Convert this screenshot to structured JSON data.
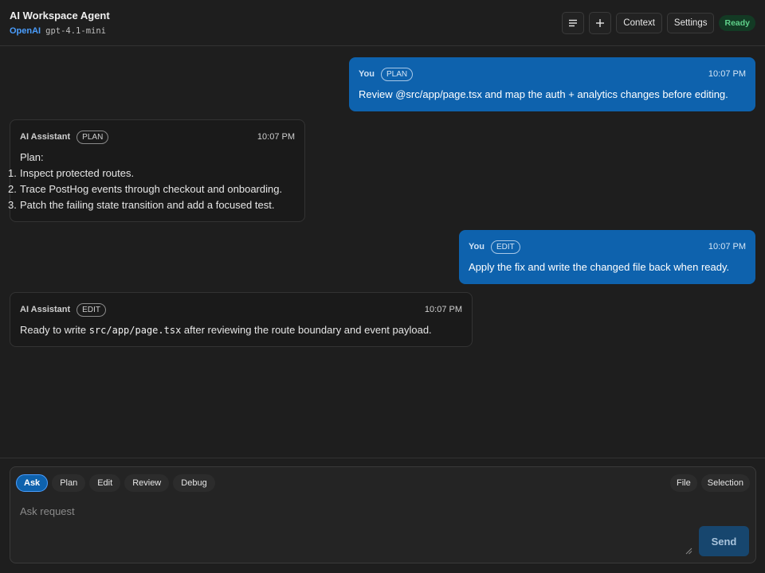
{
  "header": {
    "title": "AI Workspace Agent",
    "provider": "OpenAI",
    "model": "gpt-4.1-mini",
    "context_label": "Context",
    "settings_label": "Settings",
    "status": "Ready"
  },
  "messages": [
    {
      "role": "user",
      "author": "You",
      "mode": "PLAN",
      "time": "10:07 PM",
      "text": "Review @src/app/page.tsx and map the auth + analytics changes before editing."
    },
    {
      "role": "assistant",
      "author": "AI Assistant",
      "mode": "PLAN",
      "time": "10:07 PM",
      "intro": "Plan:",
      "steps": [
        {
          "num": "1.",
          "text": "Inspect protected routes."
        },
        {
          "num": "2.",
          "text": "Trace PostHog events through checkout and onboarding."
        },
        {
          "num": "3.",
          "text": "Patch the failing state transition and add a focused test."
        }
      ]
    },
    {
      "role": "user",
      "author": "You",
      "mode": "EDIT",
      "time": "10:07 PM",
      "text": "Apply the fix and write the changed file back when ready."
    },
    {
      "role": "assistant",
      "author": "AI Assistant",
      "mode": "EDIT",
      "time": "10:07 PM",
      "text_before": "Ready to write ",
      "code": "src/app/page.tsx",
      "text_after": " after reviewing the route boundary and event payload."
    }
  ],
  "composer": {
    "modes": [
      "Ask",
      "Plan",
      "Edit",
      "Review",
      "Debug"
    ],
    "active_mode": "Ask",
    "file_label": "File",
    "selection_label": "Selection",
    "placeholder": "Ask request",
    "value": "",
    "send_label": "Send"
  },
  "colors": {
    "accent": "#0e62ad",
    "provider": "#4a9eff",
    "status_ready": "#5fd08a"
  }
}
